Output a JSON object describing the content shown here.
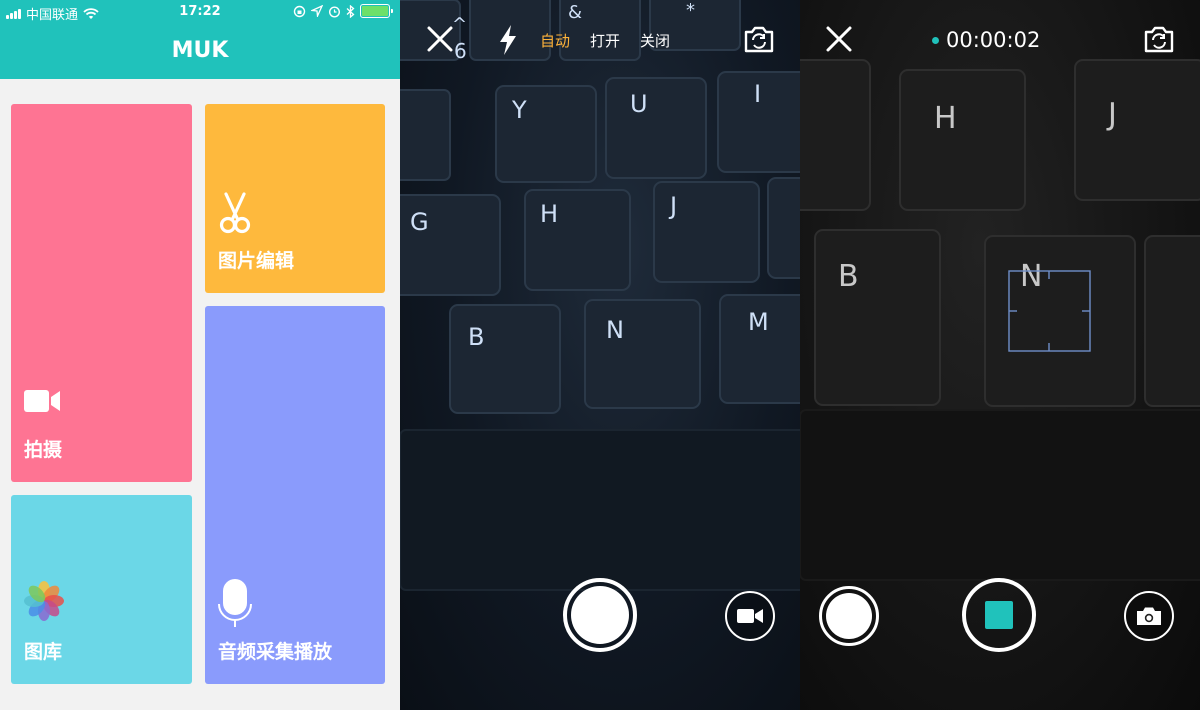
{
  "home": {
    "status": {
      "carrier": "中国联通",
      "time": "17:22"
    },
    "app_title": "MUK",
    "tiles": {
      "shoot": "拍摄",
      "edit": "图片编辑",
      "gallery": "图库",
      "audio": "音频采集播放"
    },
    "colors": {
      "header": "#20c2bb",
      "shoot": "#fe7493",
      "edit": "#feb93d",
      "gallery": "#6bd7e7",
      "audio": "#8a9bfc"
    }
  },
  "photo_camera": {
    "flash_modes": [
      "自动",
      "打开",
      "关闭"
    ],
    "active_flash_mode": "自动",
    "icons": [
      "close-icon",
      "flash-icon",
      "switch-camera-icon",
      "video-mode-icon"
    ],
    "key_legends": [
      "Y",
      "U",
      "I",
      "G",
      "H",
      "J",
      "B",
      "N",
      "M",
      "^",
      "6",
      "&",
      "*"
    ]
  },
  "video_camera": {
    "timer": "00:00:02",
    "icons": [
      "close-icon",
      "switch-camera-icon",
      "photo-mode-icon"
    ],
    "key_legends": [
      "H",
      "J",
      "B",
      "N"
    ]
  }
}
